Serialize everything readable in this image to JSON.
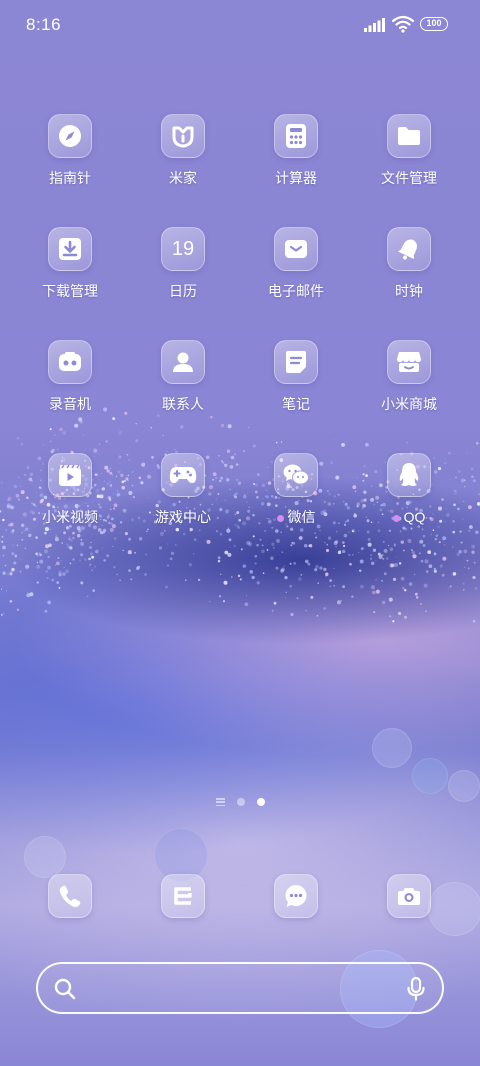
{
  "status_bar": {
    "time": "8:16",
    "battery": "100",
    "icons": [
      "signal-icon",
      "wifi-icon",
      "battery-icon"
    ]
  },
  "apps": [
    {
      "label": "指南针",
      "icon": "compass-icon"
    },
    {
      "label": "米家",
      "icon": "mijia-icon"
    },
    {
      "label": "计算器",
      "icon": "calculator-icon"
    },
    {
      "label": "文件管理",
      "icon": "folder-icon"
    },
    {
      "label": "下载管理",
      "icon": "download-icon"
    },
    {
      "label": "日历",
      "icon": "calendar-icon",
      "calendar_day": "19"
    },
    {
      "label": "电子邮件",
      "icon": "mail-icon"
    },
    {
      "label": "时钟",
      "icon": "alarm-clock-icon"
    },
    {
      "label": "录音机",
      "icon": "recorder-icon"
    },
    {
      "label": "联系人",
      "icon": "contacts-icon"
    },
    {
      "label": "笔记",
      "icon": "notes-icon"
    },
    {
      "label": "小米商城",
      "icon": "store-icon"
    },
    {
      "label": "小米视频",
      "icon": "video-icon"
    },
    {
      "label": "游戏中心",
      "icon": "gamepad-icon"
    },
    {
      "label": "微信",
      "icon": "wechat-icon",
      "new_badge": true
    },
    {
      "label": "QQ",
      "icon": "qq-icon",
      "new_badge": true
    }
  ],
  "pager": {
    "pages": 2,
    "active_page": 2
  },
  "dock": [
    {
      "name": "phone",
      "icon": "phone-icon"
    },
    {
      "name": "browser",
      "icon": "browser-icon"
    },
    {
      "name": "messages",
      "icon": "messages-icon"
    },
    {
      "name": "camera",
      "icon": "camera-icon"
    }
  ],
  "search": {
    "placeholder": "",
    "icons": [
      "search-icon",
      "microphone-icon"
    ]
  },
  "colors": {
    "accent_badge": "#d68cf0",
    "background_top": "#8c87d4"
  }
}
